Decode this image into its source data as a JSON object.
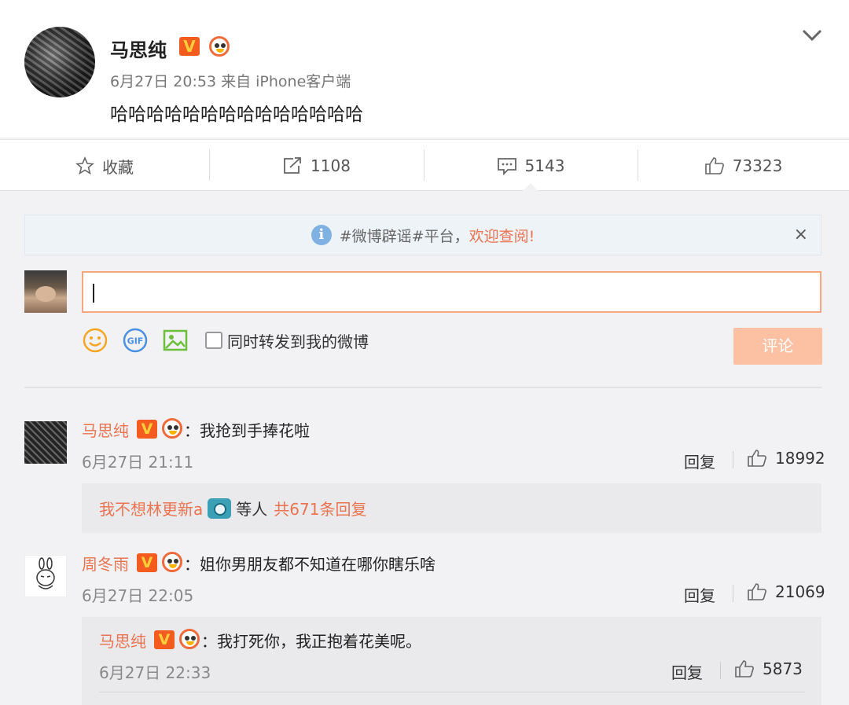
{
  "post": {
    "author": "马思纯",
    "meta": "6月27日 20:53 来自 iPhone客户端",
    "text": "哈哈哈哈哈哈哈哈哈哈哈哈哈哈",
    "verified_badge": "V"
  },
  "actions": {
    "favorite": "收藏",
    "repost_count": "1108",
    "comment_count": "5143",
    "like_count": "73323"
  },
  "notice": {
    "text": "#微博辟谣#平台，",
    "link": "欢迎查阅!",
    "close": "×"
  },
  "compose": {
    "forward_label": "同时转发到我的微博",
    "submit_label": "评论"
  },
  "comments": [
    {
      "user": "马思纯",
      "text": "：我抢到手捧花啦",
      "date": "6月27日 21:11",
      "reply": "回复",
      "likes": "18992",
      "sub_user": "我不想林更新a",
      "sub_mid": "等人",
      "sub_count": "共671条回复"
    },
    {
      "user": "周冬雨",
      "text": "：姐你男朋友都不知道在哪你瞎乐啥",
      "date": "6月27日 22:05",
      "reply": "回复",
      "likes": "21069"
    }
  ],
  "nested_reply": {
    "user": "马思纯",
    "text": "：我打死你，我正抱着花美呢。",
    "date": "6月27日 22:33",
    "reply": "回复",
    "likes": "5873"
  },
  "colors": {
    "accent": "#eb7350",
    "vip": "#f35b1f",
    "submit_disabled": "#fcc0a2"
  },
  "icons": [
    "chevron-down-icon",
    "star-icon",
    "share-icon",
    "comment-icon",
    "thumb-up-icon",
    "info-icon",
    "emoji-icon",
    "gif-icon",
    "image-icon",
    "camera-icon"
  ]
}
